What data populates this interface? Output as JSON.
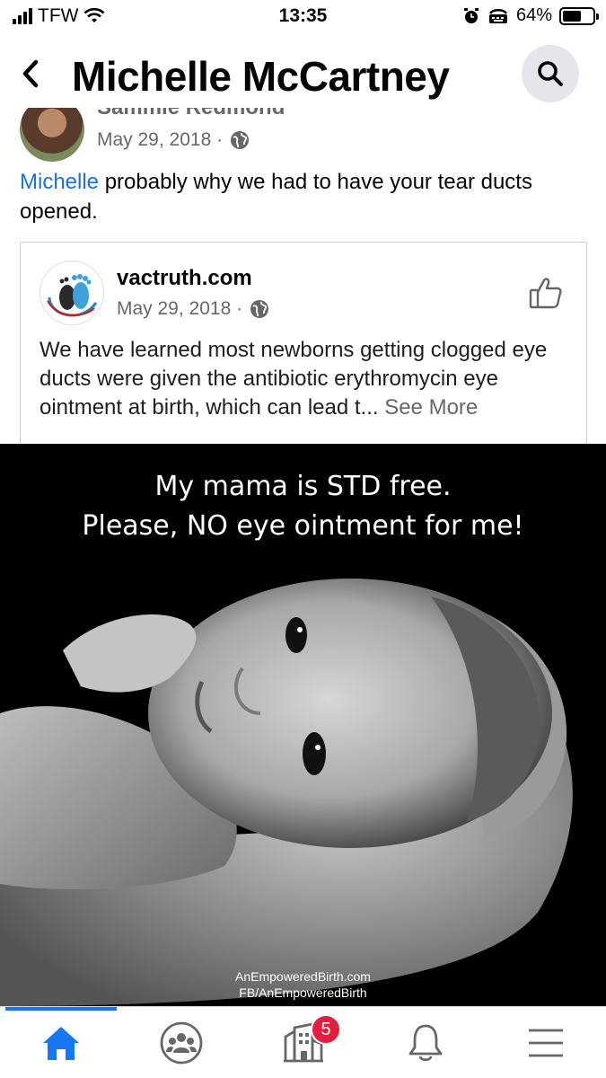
{
  "status_bar": {
    "carrier": "TFW",
    "time": "13:35",
    "battery_percent": "64%",
    "battery_level": 0.64,
    "icons": [
      "signal-icon",
      "wifi-icon",
      "alarm-icon",
      "tty-icon",
      "battery-icon"
    ]
  },
  "header": {
    "title": "Michelle McCartney",
    "back_icon": "chevron-left-icon",
    "search_icon": "search-icon"
  },
  "post": {
    "author_partial": "Sammie Redmond",
    "date": "May 29, 2018 ·",
    "privacy_icon": "globe-icon",
    "mention": "Michelle",
    "text": " probably why we had to have your tear ducts opened."
  },
  "link_card": {
    "source": "vactruth.com",
    "date": "May 29, 2018 ·",
    "privacy_icon": "globe-icon",
    "like_icon": "thumbs-up-icon",
    "text": "We have learned most newborns getting clogged eye ducts were given the antibiotic erythromycin eye ointment at birth, which can lead t... ",
    "see_more": "See More"
  },
  "image": {
    "caption_line1": "My mama is STD free.",
    "caption_line2": "Please, NO eye ointment for me!",
    "credit_line1": "AnEmpoweredBirth.com",
    "credit_line2": "FB/AnEmpoweredBirth"
  },
  "tab_bar": {
    "tabs": [
      {
        "name": "home",
        "icon": "home-icon",
        "active": true
      },
      {
        "name": "groups",
        "icon": "groups-icon",
        "active": false
      },
      {
        "name": "pages",
        "icon": "pages-icon",
        "active": false,
        "badge": "5"
      },
      {
        "name": "notifications",
        "icon": "bell-icon",
        "active": false
      },
      {
        "name": "menu",
        "icon": "hamburger-menu-icon",
        "active": false
      }
    ]
  },
  "colors": {
    "accent": "#1877f2",
    "mention": "#216fdb",
    "secondary_text": "#65676b",
    "badge": "#e41e3f"
  }
}
